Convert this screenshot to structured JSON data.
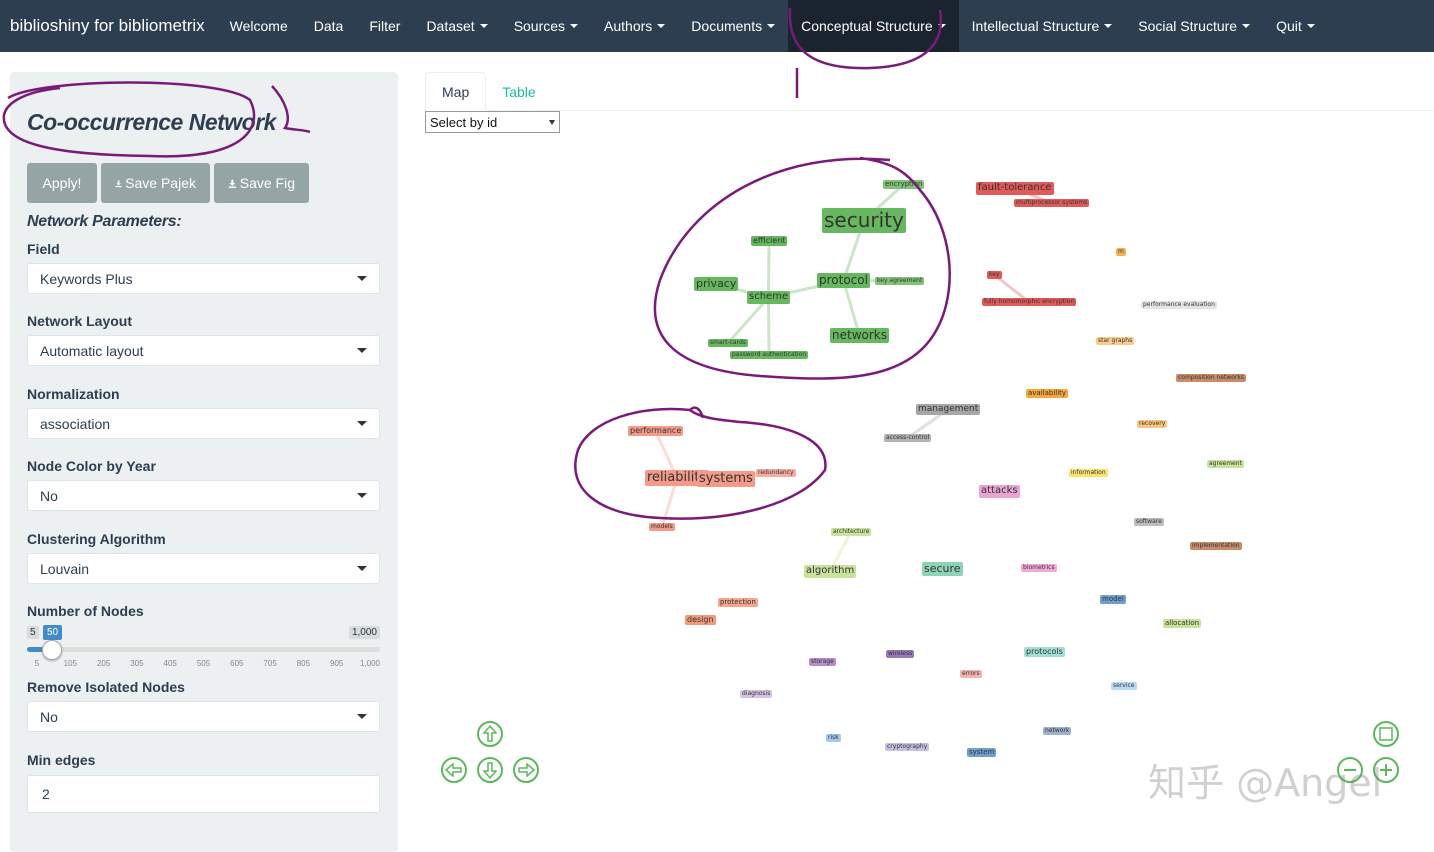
{
  "navbar": {
    "brand": "biblioshiny for bibliometrix",
    "items": [
      {
        "label": "Welcome",
        "dropdown": false
      },
      {
        "label": "Data",
        "dropdown": false
      },
      {
        "label": "Filter",
        "dropdown": false
      },
      {
        "label": "Dataset",
        "dropdown": true
      },
      {
        "label": "Sources",
        "dropdown": true
      },
      {
        "label": "Authors",
        "dropdown": true
      },
      {
        "label": "Documents",
        "dropdown": true
      },
      {
        "label": "Conceptual Structure",
        "dropdown": true,
        "active": true
      },
      {
        "label": "Intellectual Structure",
        "dropdown": true
      },
      {
        "label": "Social Structure",
        "dropdown": true
      },
      {
        "label": "Quit",
        "dropdown": true
      }
    ]
  },
  "sidebar": {
    "title": "Co-occurrence Network",
    "buttons": {
      "apply": "Apply!",
      "save_pajek": "Save Pajek",
      "save_fig": "Save Fig"
    },
    "params_title": "Network Parameters:",
    "field": {
      "label": "Field",
      "value": "Keywords Plus"
    },
    "layout": {
      "label": "Network Layout",
      "value": "Automatic layout"
    },
    "normalization": {
      "label": "Normalization",
      "value": "association"
    },
    "color_by_year": {
      "label": "Node Color by Year",
      "value": "No"
    },
    "clustering": {
      "label": "Clustering Algorithm",
      "value": "Louvain"
    },
    "nodes": {
      "label": "Number of Nodes",
      "min": "5",
      "max": "1,000",
      "value": "50",
      "ticks": [
        "5",
        "105",
        "205",
        "305",
        "405",
        "505",
        "605",
        "705",
        "805",
        "905",
        "1,000"
      ]
    },
    "remove_isolated": {
      "label": "Remove Isolated Nodes",
      "value": "No"
    },
    "min_edges": {
      "label": "Min edges",
      "value": "2"
    }
  },
  "main": {
    "tabs": [
      "Map",
      "Table"
    ],
    "select_placeholder": "Select by id"
  },
  "network_nodes": [
    {
      "label": "security",
      "color": "#66b85e"
    },
    {
      "label": "encryption",
      "color": "#7fc476"
    },
    {
      "label": "efficient",
      "color": "#66b85e"
    },
    {
      "label": "privacy",
      "color": "#66b85e"
    },
    {
      "label": "scheme",
      "color": "#66b85e"
    },
    {
      "label": "protocol",
      "color": "#66b85e"
    },
    {
      "label": "key agreement",
      "color": "#7fc476"
    },
    {
      "label": "networks",
      "color": "#66b85e"
    },
    {
      "label": "smart-cards",
      "color": "#66b85e"
    },
    {
      "label": "password authentication",
      "color": "#66b85e"
    },
    {
      "label": "fault-tolerance",
      "color": "#e05a5a"
    },
    {
      "label": "multiprocessor systems",
      "color": "#e05a5a"
    },
    {
      "label": "key",
      "color": "#e05a5a"
    },
    {
      "label": "fully homomorphic encryption",
      "color": "#e05a5a"
    },
    {
      "label": "performance evaluation",
      "color": "#e4e4e4"
    },
    {
      "label": "m",
      "color": "#f5b251"
    },
    {
      "label": "star graphs",
      "color": "#f9cc8c"
    },
    {
      "label": "composition networks",
      "color": "#c98c6b"
    },
    {
      "label": "availability",
      "color": "#f5a83b"
    },
    {
      "label": "recovery",
      "color": "#f9c77e"
    },
    {
      "label": "management",
      "color": "#a6a6a6"
    },
    {
      "label": "access-control",
      "color": "#b3b3b3"
    },
    {
      "label": "performance",
      "color": "#f39a89"
    },
    {
      "label": "reliability",
      "color": "#f39a89"
    },
    {
      "label": "systems",
      "color": "#f39a89"
    },
    {
      "label": "redundancy",
      "color": "#f6ada0"
    },
    {
      "label": "models",
      "color": "#f39a89"
    },
    {
      "label": "information",
      "color": "#fbe36b"
    },
    {
      "label": "agreement",
      "color": "#c8e39c"
    },
    {
      "label": "attacks",
      "color": "#e9a4d2"
    },
    {
      "label": "software",
      "color": "#bdbdbd"
    },
    {
      "label": "implementation",
      "color": "#c98c6b"
    },
    {
      "label": "architecture",
      "color": "#c8e39c"
    },
    {
      "label": "algorithm",
      "color": "#c8e39c"
    },
    {
      "label": "secure",
      "color": "#8fd3b6"
    },
    {
      "label": "biometrics",
      "color": "#f3a9d8"
    },
    {
      "label": "model",
      "color": "#6f9fd1"
    },
    {
      "label": "allocation",
      "color": "#c8e39c"
    },
    {
      "label": "protection",
      "color": "#f7a58f"
    },
    {
      "label": "design",
      "color": "#f39a7c"
    },
    {
      "label": "storage",
      "color": "#b58fc6"
    },
    {
      "label": "wireless",
      "color": "#9a79b8"
    },
    {
      "label": "errors",
      "color": "#f6b1ab"
    },
    {
      "label": "protocols",
      "color": "#a2ded4"
    },
    {
      "label": "service",
      "color": "#b9daf3"
    },
    {
      "label": "diagnosis",
      "color": "#d5c3e3"
    },
    {
      "label": "risk",
      "color": "#a6c8ea"
    },
    {
      "label": "cryptography",
      "color": "#c5c1e4"
    },
    {
      "label": "system",
      "color": "#6f9fd1"
    },
    {
      "label": "network",
      "color": "#9fb0d0"
    }
  ],
  "colors": {
    "navbar": "#2c3e50",
    "accent": "#18bc9c",
    "sidebar": "#ecf0f1",
    "button": "#95a5a6"
  },
  "watermark": "知乎 @Angel"
}
